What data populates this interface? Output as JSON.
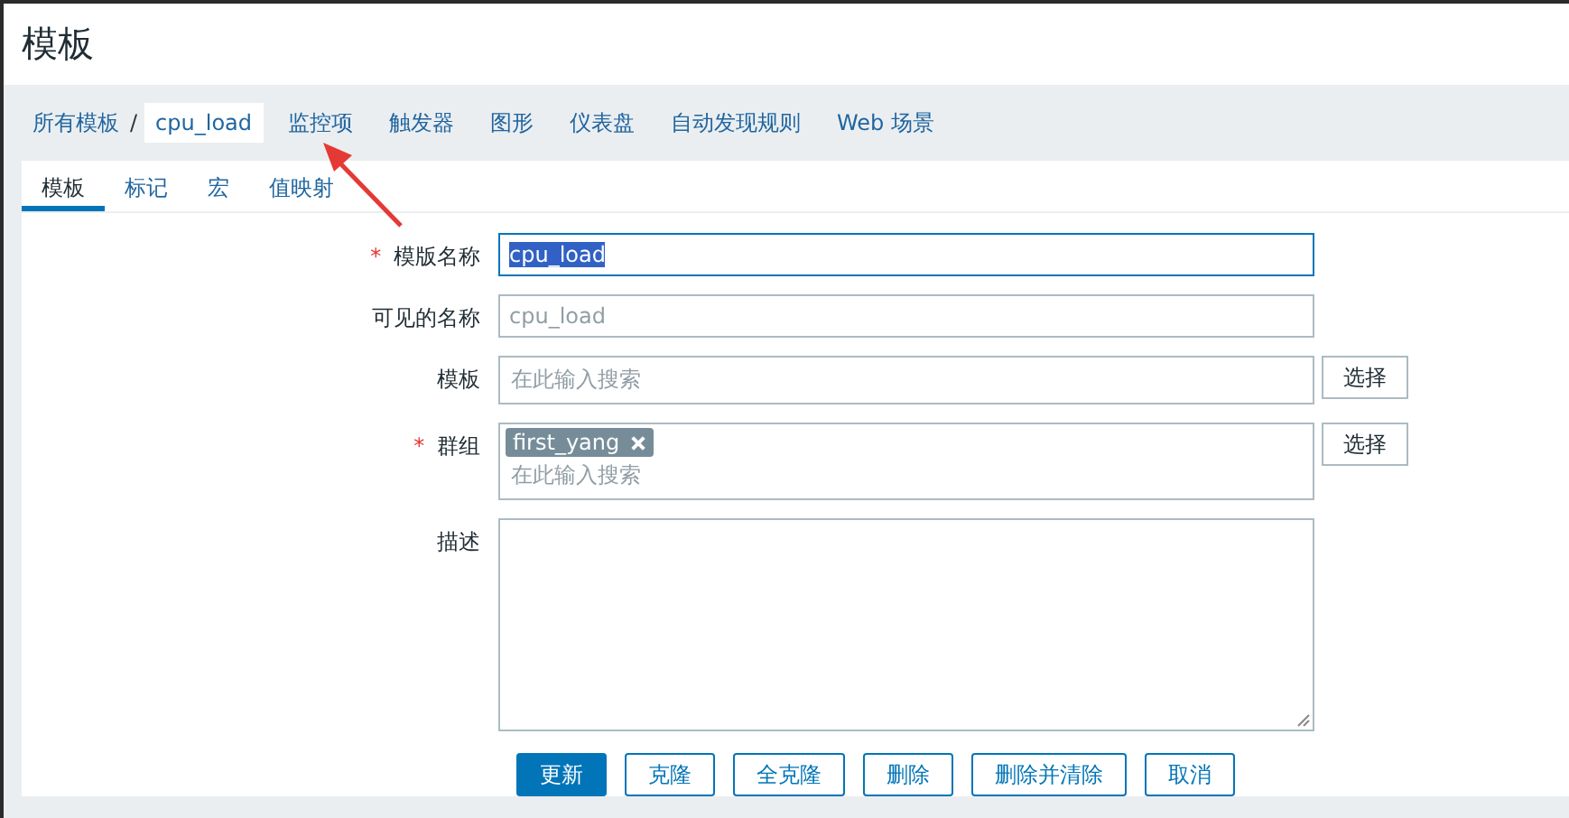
{
  "page_title": "模板",
  "breadcrumb": {
    "root": "所有模板",
    "separator": "/",
    "current": "cpu_load"
  },
  "nav": [
    "监控项",
    "触发器",
    "图形",
    "仪表盘",
    "自动发现规则",
    "Web 场景"
  ],
  "tabs": [
    {
      "label": "模板",
      "selected": true
    },
    {
      "label": "标记",
      "selected": false
    },
    {
      "label": "宏",
      "selected": false
    },
    {
      "label": "值映射",
      "selected": false
    }
  ],
  "form": [
    {
      "kind": "text",
      "label": "模版名称",
      "required_mark": "*",
      "value": "cpu_load",
      "highlighted": true,
      "focused": true
    },
    {
      "kind": "text",
      "label": "可见的名称",
      "placeholder": "cpu_load"
    },
    {
      "kind": "multiselect",
      "label": "模板",
      "placeholder": "在此输入搜索",
      "button": "选择"
    },
    {
      "kind": "multiselect",
      "label": "群组",
      "required_mark": "*",
      "tags": [
        "first_yang"
      ],
      "placeholder": "在此输入搜索",
      "button": "选择"
    },
    {
      "kind": "textarea",
      "label": "描述"
    }
  ],
  "actions": [
    {
      "label": "更新",
      "primary": true
    },
    {
      "label": "克隆",
      "primary": false
    },
    {
      "label": "全克隆",
      "primary": false
    },
    {
      "label": "删除",
      "primary": false
    },
    {
      "label": "删除并清除",
      "primary": false
    },
    {
      "label": "取消",
      "primary": false
    }
  ],
  "annotation": {
    "kind": "arrow"
  }
}
